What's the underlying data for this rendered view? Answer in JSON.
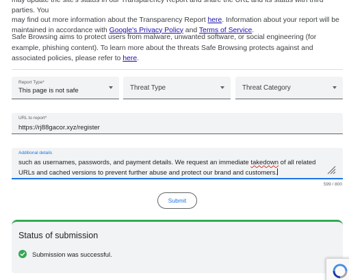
{
  "intro": {
    "line1": "may update the site's status in our Transparency Report and share the URL and its status with third parties. You",
    "line2_pre": "may find out more information about the Transparency Report ",
    "line2_link": "here",
    "line2_post": ". Information about your report will be",
    "line3_pre": "maintained in accordance with ",
    "privacy_link": "Google's Privacy Policy",
    "line3_mid": " and ",
    "terms_link": "Terms of Service",
    "line3_post": "."
  },
  "safe_browsing": {
    "text": "Safe Browsing aims to protect users from malware, unwanted software, or social engineering (for example, phishing content). To learn more about the threats Safe Browsing protects against and associated policies, please refer to ",
    "link": "here",
    "end": "."
  },
  "form": {
    "report_type": {
      "label": "Report Type*",
      "value": "This page is not safe"
    },
    "threat_type": {
      "placeholder": "Threat Type"
    },
    "threat_category": {
      "placeholder": "Threat Category"
    },
    "url": {
      "label": "URL to report*",
      "value": "https://rj88gacor.xyz/register"
    },
    "details": {
      "label": "Additional details",
      "text_pre": "such as usernames, passwords, and payment details. We request an immediate ",
      "text_misspelled": "takedown",
      "text_post": " of all related\nURLs and cached versions to prevent further abuse and protect our brand and customers.",
      "counter": "599 / 800"
    },
    "submit_label": "Submit"
  },
  "status": {
    "title": "Status of submission",
    "message": "Submission was successful."
  },
  "colors": {
    "accent": "#1a73e8",
    "success": "#34a853",
    "link": "#1a0dab",
    "field_bg": "#f1f3f4"
  },
  "icons": {
    "dropdown": "chevron-down-icon",
    "success": "check-circle-icon",
    "resize": "resize-handle-icon",
    "recaptcha": "recaptcha-logo-icon"
  }
}
